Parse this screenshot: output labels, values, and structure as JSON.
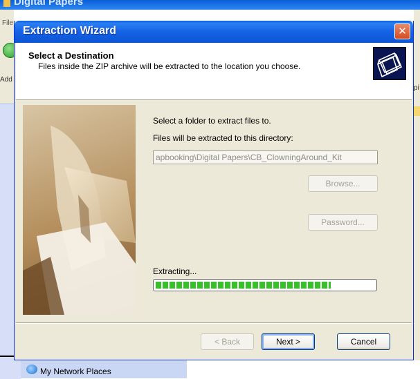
{
  "background_window": {
    "title": "Digital Papers",
    "menu_fragment": "File",
    "address_fragment": "Add",
    "right_fragment": "pi",
    "network_places_label": "My Network Places"
  },
  "dialog": {
    "title": "Extraction Wizard",
    "close_glyph": "✕",
    "header": {
      "title": "Select a Destination",
      "subtitle": "Files inside the ZIP archive will be extracted to the location you choose."
    },
    "instruction": "Select a folder to extract files to.",
    "directory_label": "Files will be extracted to this directory:",
    "directory_value": "apbooking\\Digital Papers\\CB_ClowningAround_Kit",
    "browse_label": "Browse...",
    "password_label": "Password...",
    "status_label": "Extracting...",
    "progress_fraction": 0.8,
    "buttons": {
      "back_label": "< Back",
      "next_label": "Next >",
      "cancel_label": "Cancel"
    }
  },
  "colors": {
    "titlebar": "#0b54d4",
    "progress": "#37c02a",
    "dialog_bg": "#ece9d8"
  },
  "icons": {
    "header": "folders-icon",
    "close": "close-icon",
    "back": "back-arrow-icon",
    "network": "network-globe-icon"
  }
}
